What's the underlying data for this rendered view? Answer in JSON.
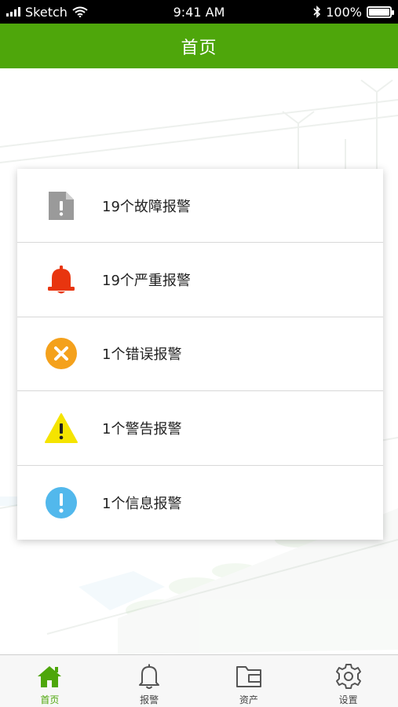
{
  "status_bar": {
    "carrier": "Sketch",
    "time": "9:41 AM",
    "battery": "100%"
  },
  "header": {
    "title": "首页"
  },
  "alarms": [
    {
      "label": "19个故障报警",
      "icon": "fault-document-icon",
      "color": "#9a9a9a"
    },
    {
      "label": "19个严重报警",
      "icon": "bell-icon",
      "color": "#e8350f"
    },
    {
      "label": "1个错误报警",
      "icon": "error-x-icon",
      "color": "#f4a11c"
    },
    {
      "label": "1个警告报警",
      "icon": "warning-triangle-icon",
      "color": "#f5e400"
    },
    {
      "label": "1个信息报警",
      "icon": "info-icon",
      "color": "#52b8ec"
    }
  ],
  "tabs": [
    {
      "label": "首页",
      "icon": "home-icon",
      "active": true
    },
    {
      "label": "报警",
      "icon": "bell-outline-icon",
      "active": false
    },
    {
      "label": "资产",
      "icon": "folder-icon",
      "active": false
    },
    {
      "label": "设置",
      "icon": "gear-icon",
      "active": false
    }
  ],
  "colors": {
    "brand_green": "#4ea60b",
    "tab_inactive": "#444444"
  }
}
